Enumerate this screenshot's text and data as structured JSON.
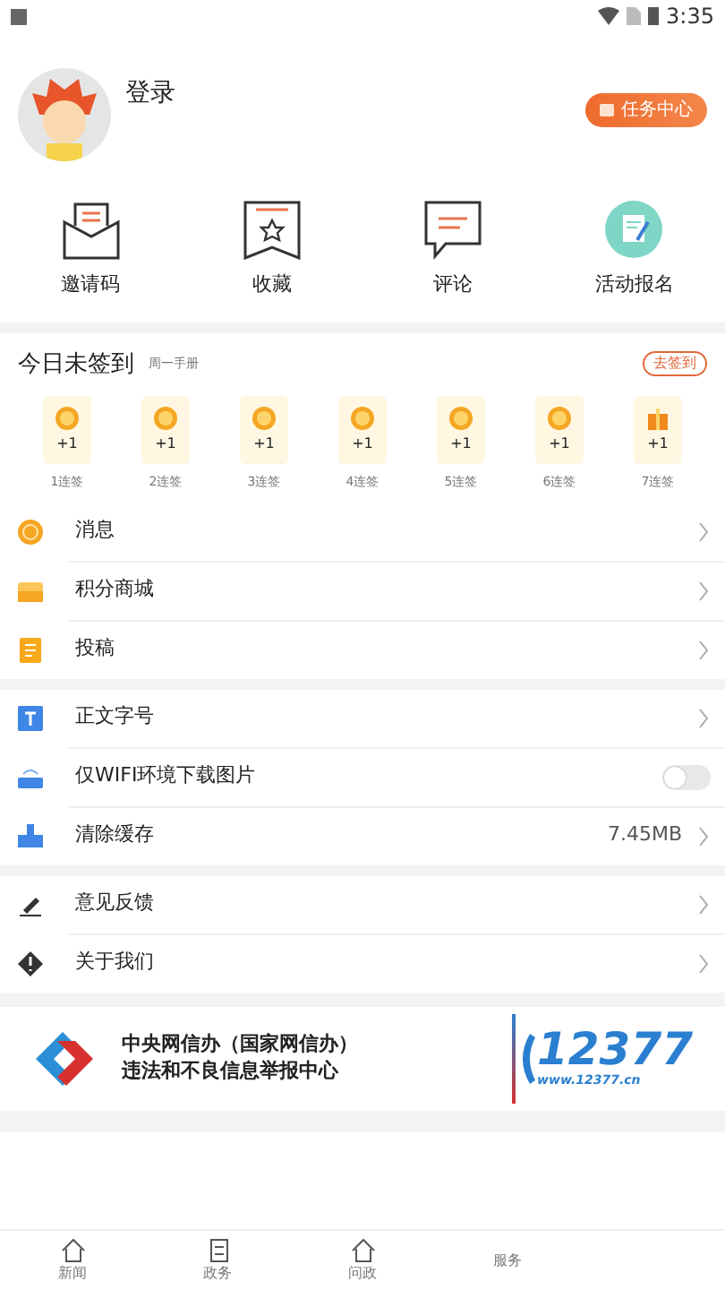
{
  "status_bar": {
    "time": "3:35"
  },
  "profile": {
    "login": "登录",
    "task_button": "任务中心"
  },
  "shortcuts": [
    {
      "label": "邀请码",
      "kind": "envelope"
    },
    {
      "label": "收藏",
      "kind": "bookmark"
    },
    {
      "label": "评论",
      "kind": "comment"
    },
    {
      "label": "活动报名",
      "kind": "signup"
    }
  ],
  "checkin": {
    "title": "今日未签到",
    "subtitle": "周一手册",
    "action": "去签到",
    "days": [
      {
        "reward": "+1",
        "label": "1连签",
        "kind": "coin"
      },
      {
        "reward": "+1",
        "label": "2连签",
        "kind": "coin"
      },
      {
        "reward": "+1",
        "label": "3连签",
        "kind": "coin"
      },
      {
        "reward": "+1",
        "label": "4连签",
        "kind": "coin"
      },
      {
        "reward": "+1",
        "label": "5连签",
        "kind": "coin"
      },
      {
        "reward": "+1",
        "label": "6连签",
        "kind": "coin"
      },
      {
        "reward": "+1",
        "label": "7连签",
        "kind": "gift"
      }
    ]
  },
  "menu_groups": [
    [
      {
        "label": "消息",
        "kind": "link"
      },
      {
        "label": "积分商城",
        "kind": "link"
      },
      {
        "label": "投稿",
        "kind": "link"
      }
    ],
    [
      {
        "label": "正文字号",
        "kind": "link"
      },
      {
        "label": "仅WIFI环境下载图片",
        "kind": "toggle",
        "on": false
      },
      {
        "label": "清除缓存",
        "kind": "value",
        "value": "7.45MB"
      }
    ],
    [
      {
        "label": "意见反馈",
        "kind": "link"
      },
      {
        "label": "关于我们",
        "kind": "link"
      }
    ]
  ],
  "banner": {
    "line_1": "中央网信办（国家网信办）",
    "line_2": "违法和不良信息举报中心",
    "number": "12377",
    "url": "www.12377.cn"
  },
  "bottom_nav": [
    {
      "label": "新闻"
    },
    {
      "label": "政务"
    },
    {
      "label": "问政"
    },
    {
      "label": "服务"
    }
  ]
}
